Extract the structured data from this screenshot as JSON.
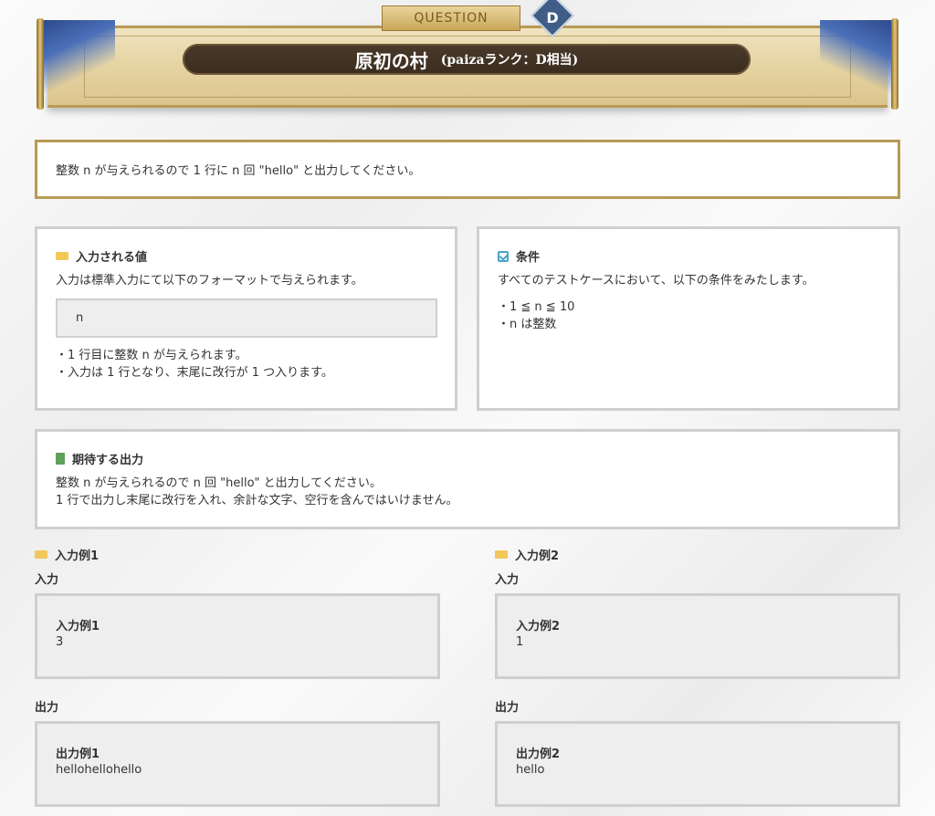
{
  "banner": {
    "question_label": "QUESTION",
    "rank_letter": "D",
    "title": "原初の村",
    "subtitle": "(paizaランク：D相当)"
  },
  "notice": "整数 n が与えられるので 1 行に n 回 \"hello\" と出力してください。",
  "input_section": {
    "heading": "入力される値",
    "description": "入力は標準入力にて以下のフォーマットで与えられます。",
    "format": "n",
    "notes": [
      "・1 行目に整数 n が与えられます。",
      "・入力は 1 行となり、末尾に改行が 1 つ入ります。"
    ]
  },
  "conditions": {
    "heading": "条件",
    "description": "すべてのテストケースにおいて、以下の条件をみたします。",
    "items": [
      "・1 ≦ n ≦ 10",
      "・n は整数"
    ]
  },
  "expected_output": {
    "heading": "期待する出力",
    "lines": [
      "整数 n が与えられるので n 回 \"hello\" と出力してください。",
      "1 行で出力し末尾に改行を入れ、余計な文字、空行を含んではいけません。"
    ]
  },
  "examples": [
    {
      "heading": "入力例1",
      "input_label": "入力",
      "input_title": "入力例1",
      "input_value": "3",
      "output_label": "出力",
      "output_title": "出力例1",
      "output_value": "hellohellohello"
    },
    {
      "heading": "入力例2",
      "input_label": "入力",
      "input_title": "入力例2",
      "input_value": "1",
      "output_label": "出力",
      "output_title": "出力例2",
      "output_value": "hello"
    }
  ],
  "colors": {
    "gold_border": "#b89a55",
    "box_border": "#cfcfcf",
    "label_icon": "#f2c85b",
    "check_icon": "#4aa3c9",
    "output_icon": "#5fa05a"
  }
}
